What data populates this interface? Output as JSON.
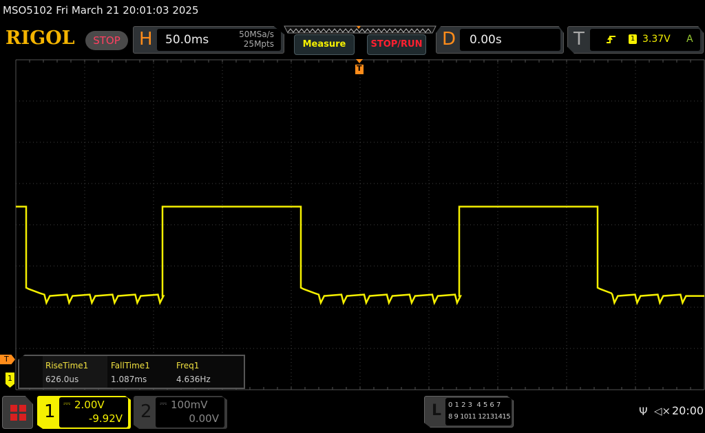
{
  "status_bar": {
    "title": "MSO5102  Fri March 21 20:01:03 2025"
  },
  "header": {
    "logo": "RIGOL",
    "run_state": "STOP",
    "horizontal": {
      "label": "H",
      "timebase": "50.0ms",
      "sample_rate": "50MSa/s",
      "memory_depth": "25Mpts"
    },
    "measure_button": "Measure",
    "stop_run_button": "STOP/RUN",
    "delay": {
      "label": "D",
      "value": "0.00s"
    },
    "trigger": {
      "label": "T",
      "edge_icon": "rising-edge-icon",
      "source": "1",
      "level": "3.37V",
      "mode": "A"
    }
  },
  "markers": {
    "trigger_top": "T",
    "trigger_level": "T",
    "channel1": "1"
  },
  "measurements": [
    {
      "name": "RiseTime1",
      "value": "626.0us"
    },
    {
      "name": "FallTime1",
      "value": "1.087ms"
    },
    {
      "name": "Freq1",
      "value": "4.636Hz"
    }
  ],
  "channels": [
    {
      "number": "1",
      "coupling_icon": "dc-icon",
      "scale": "2.00V",
      "offset": "-9.92V",
      "active": true
    },
    {
      "number": "2",
      "coupling_icon": "dc-icon",
      "scale": "100mV",
      "offset": "0.00V",
      "active": false
    }
  ],
  "logic": {
    "label": "L",
    "row1": "0 1 2 3  4 5 6 7",
    "row2": "8 9 1011 12131415"
  },
  "system": {
    "usb_icon": "usb-icon",
    "sound_icon": "mute-icon",
    "time": "20:00"
  },
  "waveform": {
    "color": "#f5f000",
    "timebase_ms_per_div": 50,
    "volts_per_div": 2,
    "offset_v": -9.92,
    "transitions_ms": [
      -242.5,
      -143.5,
      -43,
      72,
      172.5
    ],
    "initial_level": "high",
    "high_v": 10.8,
    "low_v": 6.6,
    "dip_period_ms": 16.5
  },
  "colors": {
    "accent": "#ff8c1a",
    "channel1": "#f5f000",
    "stop": "#ff4060"
  }
}
